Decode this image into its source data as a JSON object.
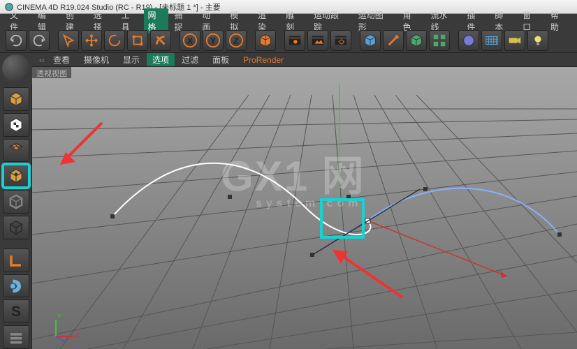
{
  "title": "CINEMA 4D R19.024 Studio (RC - R19) - [未标题 1 *] - 主要",
  "menubar": [
    "文件",
    "编辑",
    "创建",
    "选择",
    "工具",
    "网格",
    "捕捉",
    "动画",
    "模拟",
    "渲染",
    "雕刻",
    "运动跟踪",
    "运动图形",
    "角色",
    "流水线",
    "插件",
    "脚本",
    "窗口",
    "帮助"
  ],
  "menubar_highlight_index": 5,
  "viewhead": {
    "arrow": "‹‹",
    "items": [
      "查看",
      "摄像机",
      "显示",
      "选项",
      "过滤",
      "面板"
    ],
    "selected_index": 3,
    "prorender": "ProRender"
  },
  "viewport_label": "透视视图",
  "axis_labels": {
    "x": "X",
    "y": "Y",
    "z": "Z"
  },
  "watermark": {
    "big": "GX1 网",
    "sub": "system.com"
  },
  "toolbar_icons": [
    "undo",
    "redo",
    "sep",
    "pointer",
    "move-cross",
    "rotate-arc",
    "scale",
    "redo-orange",
    "sep",
    "axis-x",
    "axis-y",
    "axis-z",
    "sep",
    "cube-primitive",
    "sep",
    "film-clapper",
    "film-picture",
    "film-settings",
    "sep",
    "cube-blue",
    "pen",
    "cube-green",
    "cubes-cluster",
    "sep",
    "sphere-blue",
    "deformer-grid",
    "camera-light",
    "bulb"
  ],
  "left_icons": [
    "sphere-head",
    "cube-gold",
    "cube-checker",
    "cube-wire-orange",
    "cube-solid-gold",
    "cube-outline",
    "cube-dark",
    "sep",
    "l-shape",
    "mouse",
    "bold-s",
    "bars"
  ]
}
